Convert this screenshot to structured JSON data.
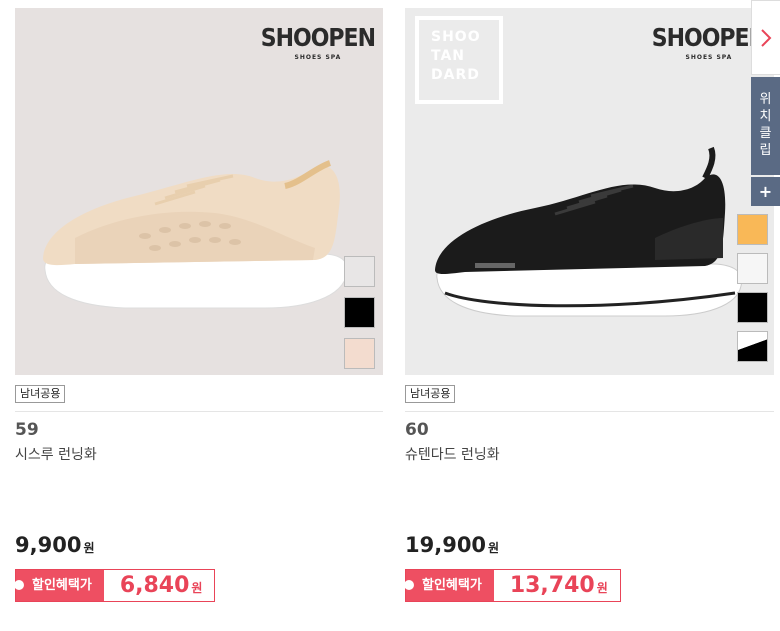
{
  "products": [
    {
      "brand": "SHOOPEN",
      "brand_sub": "SHOES SPA",
      "tag": "남녀공용",
      "rank": "59",
      "name": "시스루 런닝화",
      "price": "9,900",
      "price_unit": "원",
      "discount_label": "할인혜택가",
      "discount_price": "6,840",
      "discount_unit": "원",
      "swatches": [
        "#e8e6e6",
        "#000000",
        "#f3dccf"
      ]
    },
    {
      "brand": "SHOOPEN",
      "brand_sub": "SHOES SPA",
      "brand2_lines": [
        "SHOO",
        "TAN",
        "DARD"
      ],
      "tag": "남녀공용",
      "rank": "60",
      "name": "슈텐다드 런닝화",
      "price": "19,900",
      "price_unit": "원",
      "discount_label": "할인혜택가",
      "discount_price": "13,740",
      "discount_unit": "원",
      "swatches": [
        "#f9b857",
        "#f6f6f6",
        "#000000",
        "#1a1a1a"
      ]
    }
  ],
  "sidebar": {
    "next_icon": "chevron-right-icon",
    "wish_label": [
      "위",
      "치",
      "클",
      "립"
    ],
    "plus_label": "+"
  }
}
